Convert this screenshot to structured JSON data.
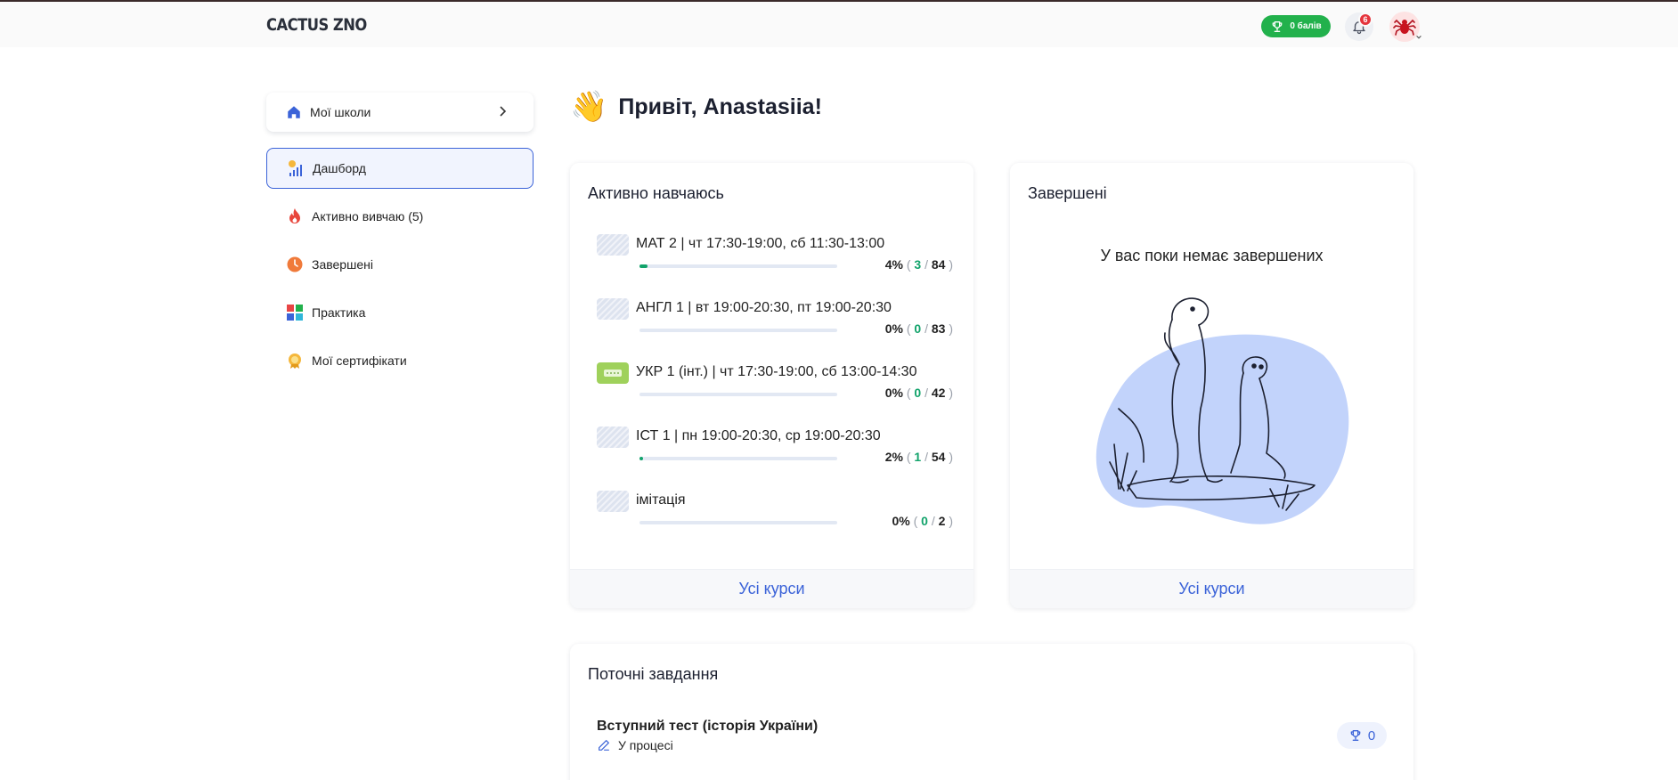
{
  "header": {
    "logo": "CACTUS ZNO",
    "points_label": "0 балів",
    "notifications_count": "6"
  },
  "sidebar": {
    "schools_label": "Мої школи",
    "items": [
      {
        "label": "Дашборд",
        "icon": "dashboard-icon",
        "active": true
      },
      {
        "label": "Активно вивчаю (5)",
        "icon": "fire-icon"
      },
      {
        "label": "Завершені",
        "icon": "clock-icon"
      },
      {
        "label": "Практика",
        "icon": "grid-icon"
      },
      {
        "label": "Мої сертифікати",
        "icon": "badge-icon"
      }
    ]
  },
  "main": {
    "greeting": "Привіт, Anastasiia!",
    "greeting_emoji": "👋",
    "active_card": {
      "title": "Активно навчаюсь",
      "footer": "Усі курси",
      "courses": [
        {
          "title": "МАТ 2 | чт 17:30-19:00, сб 11:30-13:00",
          "percent": "4%",
          "done": "3",
          "total": "84",
          "progress": 0.04
        },
        {
          "title": "АНГЛ 1 | вт 19:00-20:30, пт 19:00-20:30",
          "percent": "0%",
          "done": "0",
          "total": "83",
          "progress": 0
        },
        {
          "title": "УКР 1 (інт.) | чт 17:30-19:00, сб 13:00-14:30",
          "percent": "0%",
          "done": "0",
          "total": "42",
          "progress": 0
        },
        {
          "title": "ІСТ 1 | пн 19:00-20:30, ср 19:00-20:30",
          "percent": "2%",
          "done": "1",
          "total": "54",
          "progress": 0.02
        },
        {
          "title": "імітація",
          "percent": "0%",
          "done": "0",
          "total": "2",
          "progress": 0
        }
      ]
    },
    "finished_card": {
      "title": "Завершені",
      "empty_text": "У вас поки немає завершених",
      "footer": "Усі курси"
    },
    "tasks_card": {
      "title": "Поточні завдання",
      "tasks": [
        {
          "title": "Вступний тест (історія України)",
          "status": "У процесі",
          "score": "0"
        }
      ]
    }
  },
  "colors": {
    "accent": "#3b63d8",
    "success": "#12a36b",
    "points_green": "#22b14c",
    "badge_red": "#e5343c"
  }
}
